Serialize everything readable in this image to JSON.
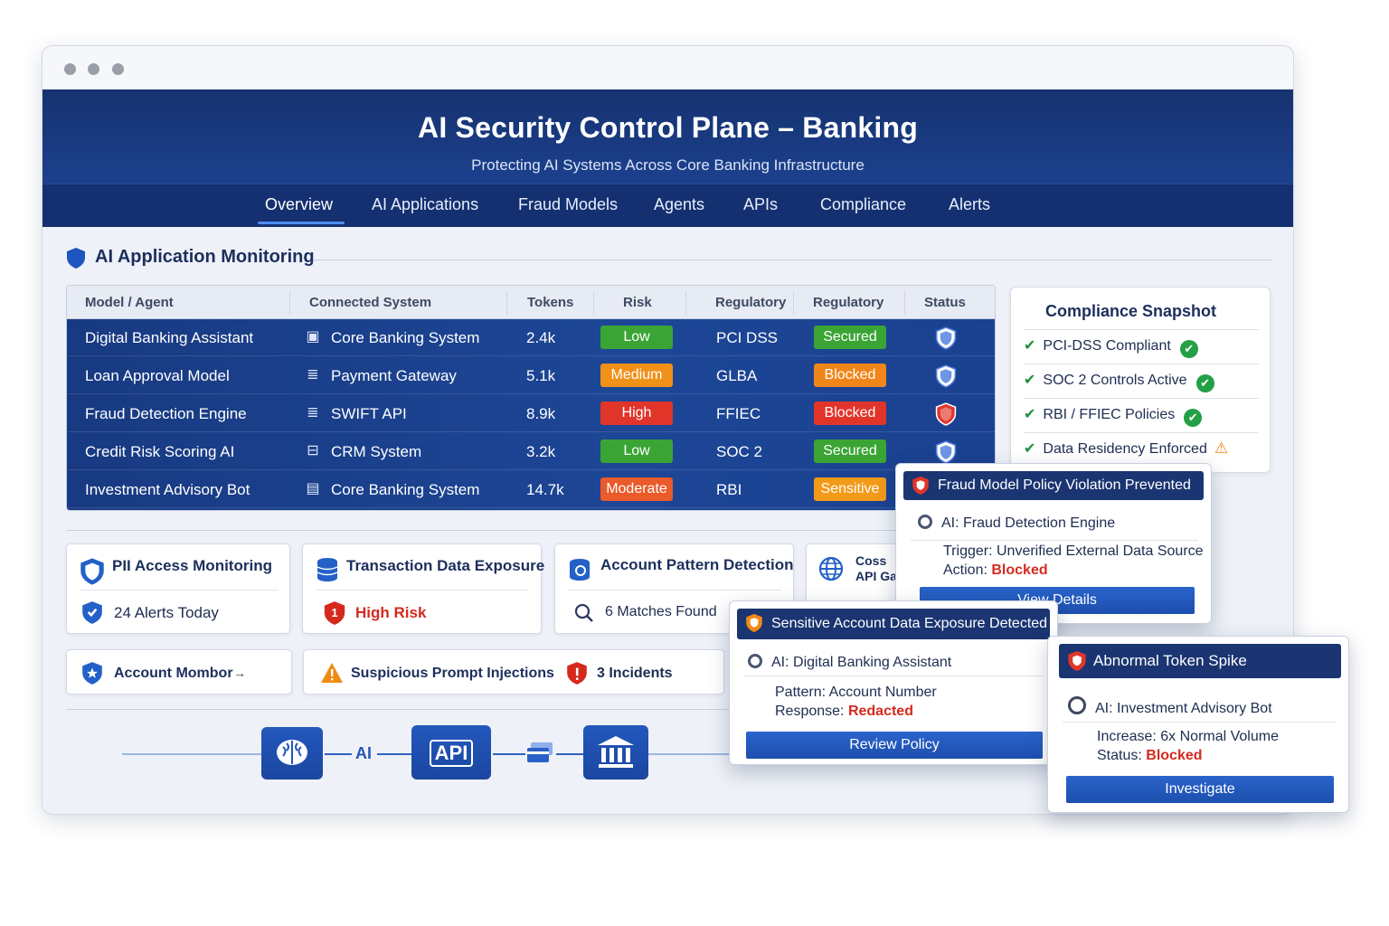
{
  "app": {
    "title": "AI Security Control Plane – Banking",
    "subtitle": "Protecting AI Systems Across Core Banking Infrastructure"
  },
  "nav": {
    "tabs": [
      "Overview",
      "AI Applications",
      "Fraud Models",
      "Agents",
      "APIs",
      "Compliance",
      "Alerts"
    ],
    "active": "Overview"
  },
  "monitoring": {
    "title": "AI Application Monitoring",
    "columns": [
      "Model / Agent",
      "Connected System",
      "Tokens",
      "Risk",
      "Regulatory",
      "Regulatory",
      "Status"
    ],
    "rows": [
      {
        "model": "Digital Banking Assistant",
        "system": "Core Banking System",
        "system_icon": "monitor-icon",
        "tokens": "2.4k",
        "risk": "Low",
        "risk_color": "#3aa535",
        "reg": "PCI DSS",
        "reg_status": "Secured",
        "reg_color": "#3aa535",
        "status_icon": "shield-check-icon"
      },
      {
        "model": "Loan Approval Model",
        "system": "Payment Gateway",
        "system_icon": "database-icon",
        "tokens": "5.1k",
        "risk": "Medium",
        "risk_color": "#f0921a",
        "reg": "GLBA",
        "reg_status": "Blocked",
        "reg_color": "#f0861a",
        "status_icon": "shield-check-icon"
      },
      {
        "model": "Fraud Detection Engine",
        "system": "SWIFT API",
        "system_icon": "database-icon",
        "tokens": "8.9k",
        "risk": "High",
        "risk_color": "#e2352a",
        "reg": "FFIEC",
        "reg_status": "Blocked",
        "reg_color": "#e2352a",
        "status_icon": "shield-alert-icon"
      },
      {
        "model": "Credit Risk Scoring AI",
        "system": "CRM System",
        "system_icon": "window-icon",
        "tokens": "3.2k",
        "risk": "Low",
        "risk_color": "#3aa535",
        "reg": "SOC 2",
        "reg_status": "Secured",
        "reg_color": "#3aa535",
        "status_icon": "shield-check-icon"
      },
      {
        "model": "Investment Advisory Bot",
        "system": "Core Banking System",
        "system_icon": "id-card-icon",
        "tokens": "14.7k",
        "risk": "Moderate",
        "risk_color": "#ea5a2a",
        "reg": "RBI",
        "reg_status": "Sensitive",
        "reg_color": "#f39a18",
        "status_icon": "shield-check-icon"
      }
    ]
  },
  "compliance": {
    "title": "Compliance Snapshot",
    "items": [
      {
        "label": "PCI-DSS Compliant",
        "state": "ok"
      },
      {
        "label": "SOC 2 Controls Active",
        "state": "ok"
      },
      {
        "label": "RBI / FFIEC Policies",
        "state": "ok"
      },
      {
        "label": "Data Residency Enforced",
        "state": "warn"
      }
    ]
  },
  "cards": {
    "pii": {
      "title": "PII Access Monitoring",
      "value": "24 Alerts Today"
    },
    "transaction": {
      "title": "Transaction Data Exposure",
      "value": "High Risk",
      "badge": "1"
    },
    "pattern": {
      "title": "Account Pattern Detection",
      "value": "6 Matches Found"
    },
    "cross": {
      "title_line1": "Coss",
      "title_line2": "API Ga"
    },
    "account": {
      "title": "Account Mombor",
      "arrow": "→"
    },
    "prompt": {
      "title": "Suspicious Prompt Injections",
      "value": "3 Incidents"
    }
  },
  "flow": {
    "ai_label": "AI",
    "api_label": "API"
  },
  "popups": {
    "fraud": {
      "title": "Fraud Model Policy Violation Prevented",
      "ai_prefix": "AI:",
      "ai": "Fraud Detection Engine",
      "line1_label": "Trigger:",
      "line1_value": "Unverified External Data Source",
      "line2_label": "Action:",
      "line2_value": "Blocked",
      "button": "View Details"
    },
    "sensitive": {
      "title": "Sensitive Account Data Exposure Detected",
      "ai_prefix": "AI:",
      "ai": "Digital Banking Assistant",
      "line1_label": "Pattern:",
      "line1_value": "Account Number",
      "line2_label": "Response:",
      "line2_value": "Redacted",
      "button": "Review Policy"
    },
    "token": {
      "title": "Abnormal Token Spike",
      "ai_prefix": "AI:",
      "ai": "Investment Advisory Bot",
      "line1_label": "Increase:",
      "line1_value": "6x Normal Volume",
      "line2_label": "Status:",
      "line2_value": "Blocked",
      "button": "Investigate"
    }
  }
}
